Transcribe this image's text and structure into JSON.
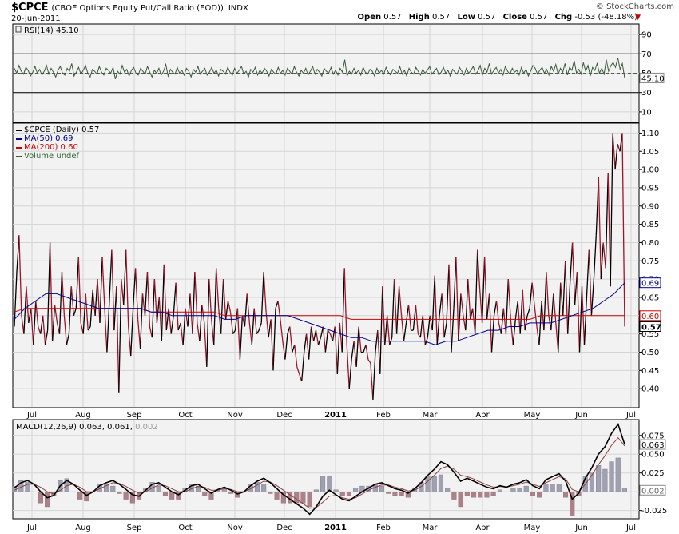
{
  "header": {
    "symbol": "$CPCE",
    "description": "(CBOE Options Equity Put/Call Ratio (EOD))",
    "exchange": "INDX",
    "credit": "© StockCharts.com",
    "date": "20-Jun-2011",
    "open_label": "Open",
    "open": "0.57",
    "high_label": "High",
    "high": "0.57",
    "low_label": "Low",
    "low": "0.57",
    "close_label": "Close",
    "close": "0.57",
    "chg_label": "Chg",
    "chg": "-0.53 (-48.18%)"
  },
  "colors": {
    "price_up": "#000000",
    "price_down": "#a0142a",
    "ma50": "#00008b",
    "ma200": "#cc0000",
    "rsi_line": "#3a5a3a",
    "macd_line": "#000000",
    "signal_line": "#8b4040",
    "hist_pos": "#a0a0b4",
    "hist_neg": "#b08088",
    "panel_bg": "#f2f2f2",
    "grid": "#d4d4d4"
  },
  "chart_data": [
    {
      "type": "line",
      "panel": "RSI",
      "legend": "RSI(14) 45.10",
      "y_ticks": [
        10,
        30,
        50,
        70,
        90
      ],
      "ylim": [
        0,
        100
      ],
      "overbought": 70,
      "oversold": 30,
      "last_value": 45.1,
      "last_value_label": "45.10",
      "values": [
        55,
        50,
        58,
        52,
        49,
        56,
        53,
        47,
        51,
        57,
        50,
        54,
        48,
        52,
        58,
        49,
        55,
        51,
        46,
        53,
        57,
        50,
        48,
        55,
        52,
        60,
        47,
        51,
        56,
        49,
        53,
        58,
        50,
        46,
        54,
        52,
        49,
        57,
        51,
        48,
        55,
        53,
        50,
        56,
        44,
        52,
        49,
        58,
        51,
        54,
        47,
        53,
        56,
        50,
        48,
        55,
        52,
        49,
        57,
        51,
        46,
        53,
        50,
        55,
        48,
        52,
        59,
        47,
        54,
        51,
        49,
        56,
        50,
        53,
        48,
        55,
        52,
        46,
        54,
        51,
        57,
        49,
        52,
        55,
        48,
        51,
        56,
        50,
        53,
        47,
        54,
        52,
        49,
        56,
        51,
        48,
        55,
        50,
        53,
        57,
        49,
        52,
        46,
        54,
        51,
        56,
        48,
        53,
        50,
        55,
        52,
        47,
        54,
        51,
        49,
        56,
        50,
        53,
        48,
        55,
        52,
        49,
        57,
        51,
        47,
        53,
        50,
        55,
        48,
        52,
        57,
        49,
        54,
        51,
        47,
        55,
        52,
        50,
        56,
        49,
        53,
        48,
        55,
        51,
        64,
        47,
        52,
        49,
        55,
        50,
        53,
        48,
        56,
        51,
        49,
        54,
        52,
        47,
        55,
        50,
        53,
        49,
        56,
        51,
        48,
        54,
        52,
        50,
        57,
        49,
        53,
        47,
        55,
        51,
        49,
        56,
        52,
        48,
        54,
        50,
        53,
        57,
        49,
        52,
        55,
        48,
        51,
        56,
        50,
        53,
        47,
        54,
        51,
        49,
        56,
        52,
        48,
        55,
        50,
        53,
        57,
        49,
        52,
        58,
        48,
        55,
        51,
        60,
        49,
        53,
        56,
        50,
        54,
        48,
        57,
        52,
        49,
        55,
        51,
        53,
        48,
        56,
        50,
        54,
        47,
        52,
        58,
        55,
        49,
        53,
        56,
        50,
        54,
        48,
        57,
        52,
        59,
        49,
        55,
        51,
        60,
        48,
        56,
        53,
        63,
        50,
        54,
        49,
        61,
        52,
        58,
        47,
        56,
        53,
        60,
        50,
        55,
        49,
        64,
        52,
        58,
        61,
        56,
        66,
        54,
        60,
        45
      ]
    },
    {
      "type": "line",
      "panel": "Price",
      "legend": [
        "$CPCE (Daily) 0.57",
        "MA(50) 0.69",
        "MA(200) 0.60",
        "Volume undef"
      ],
      "series": [
        {
          "name": "$CPCE (Daily)",
          "values": [
            0.57,
            0.72,
            0.82,
            0.6,
            0.55,
            0.68,
            0.58,
            0.62,
            0.52,
            0.64,
            0.57,
            0.55,
            0.6,
            0.52,
            0.56,
            0.8,
            0.53,
            0.63,
            0.58,
            0.55,
            0.72,
            0.6,
            0.52,
            0.55,
            0.68,
            0.6,
            0.62,
            0.76,
            0.58,
            0.55,
            0.66,
            0.56,
            0.57,
            0.67,
            0.6,
            0.7,
            0.58,
            0.76,
            0.62,
            0.5,
            0.64,
            0.78,
            0.56,
            0.68,
            0.39,
            0.7,
            0.63,
            0.78,
            0.57,
            0.49,
            0.62,
            0.73,
            0.59,
            0.51,
            0.66,
            0.6,
            0.72,
            0.57,
            0.54,
            0.7,
            0.58,
            0.65,
            0.53,
            0.74,
            0.56,
            0.62,
            0.55,
            0.6,
            0.69,
            0.56,
            0.58,
            0.52,
            0.62,
            0.57,
            0.66,
            0.55,
            0.72,
            0.58,
            0.53,
            0.63,
            0.58,
            0.46,
            0.7,
            0.59,
            0.52,
            0.73,
            0.62,
            0.55,
            0.7,
            0.59,
            0.64,
            0.61,
            0.55,
            0.56,
            0.62,
            0.48,
            0.6,
            0.57,
            0.66,
            0.58,
            0.52,
            0.62,
            0.55,
            0.56,
            0.58,
            0.72,
            0.61,
            0.54,
            0.59,
            0.45,
            0.62,
            0.64,
            0.59,
            0.53,
            0.48,
            0.55,
            0.57,
            0.5,
            0.52,
            0.46,
            0.44,
            0.42,
            0.5,
            0.55,
            0.48,
            0.57,
            0.53,
            0.56,
            0.52,
            0.54,
            0.57,
            0.5,
            0.56,
            0.55,
            0.53,
            0.57,
            0.44,
            0.58,
            0.5,
            0.73,
            0.52,
            0.4,
            0.48,
            0.53,
            0.46,
            0.57,
            0.5,
            0.5,
            0.52,
            0.48,
            0.47,
            0.37,
            0.5,
            0.56,
            0.44,
            0.68,
            0.52,
            0.6,
            0.52,
            0.54,
            0.7,
            0.55,
            0.68,
            0.6,
            0.53,
            0.58,
            0.63,
            0.56,
            0.56,
            0.63,
            0.55,
            0.54,
            0.6,
            0.52,
            0.54,
            0.6,
            0.56,
            0.71,
            0.52,
            0.6,
            0.66,
            0.54,
            0.58,
            0.74,
            0.5,
            0.62,
            0.76,
            0.53,
            0.66,
            0.6,
            0.56,
            0.7,
            0.59,
            0.62,
            0.55,
            0.78,
            0.67,
            0.58,
            0.76,
            0.59,
            0.66,
            0.5,
            0.6,
            0.64,
            0.58,
            0.55,
            0.62,
            0.55,
            0.7,
            0.59,
            0.52,
            0.59,
            0.64,
            0.55,
            0.67,
            0.56,
            0.6,
            0.62,
            0.69,
            0.63,
            0.57,
            0.52,
            0.64,
            0.56,
            0.72,
            0.6,
            0.56,
            0.66,
            0.58,
            0.5,
            0.69,
            0.6,
            0.75,
            0.55,
            0.69,
            0.8,
            0.63,
            0.72,
            0.5,
            0.68,
            0.52,
            0.65,
            0.78,
            0.6,
            0.7,
            0.82,
            0.98,
            0.7,
            0.8,
            0.73,
            0.99,
            0.68,
            1.1,
            1.0,
            1.07,
            1.05,
            1.1,
            0.57
          ]
        },
        {
          "name": "MA(50)",
          "values": [
            0.59,
            0.62,
            0.64,
            0.66,
            0.66,
            0.65,
            0.64,
            0.63,
            0.62,
            0.62,
            0.62,
            0.62,
            0.62,
            0.61,
            0.61,
            0.6,
            0.6,
            0.6,
            0.6,
            0.6,
            0.59,
            0.59,
            0.6,
            0.6,
            0.6,
            0.6,
            0.6,
            0.59,
            0.58,
            0.57,
            0.56,
            0.55,
            0.54,
            0.54,
            0.53,
            0.53,
            0.53,
            0.53,
            0.53,
            0.53,
            0.52,
            0.53,
            0.53,
            0.54,
            0.55,
            0.56,
            0.56,
            0.57,
            0.57,
            0.58,
            0.58,
            0.58,
            0.59,
            0.6,
            0.61,
            0.62,
            0.64,
            0.66,
            0.69
          ]
        },
        {
          "name": "MA(200)",
          "values": [
            0.61,
            0.62,
            0.62,
            0.62,
            0.62,
            0.62,
            0.62,
            0.62,
            0.62,
            0.62,
            0.62,
            0.62,
            0.62,
            0.61,
            0.61,
            0.61,
            0.61,
            0.61,
            0.61,
            0.61,
            0.6,
            0.6,
            0.6,
            0.6,
            0.6,
            0.6,
            0.6,
            0.6,
            0.6,
            0.6,
            0.6,
            0.6,
            0.59,
            0.59,
            0.59,
            0.59,
            0.59,
            0.59,
            0.59,
            0.59,
            0.59,
            0.59,
            0.59,
            0.59,
            0.59,
            0.59,
            0.59,
            0.59,
            0.59,
            0.59,
            0.6,
            0.6,
            0.6,
            0.6,
            0.6,
            0.6,
            0.6,
            0.6,
            0.6
          ]
        }
      ],
      "y_ticks": [
        "0.40",
        "0.45",
        "0.50",
        "0.55",
        "0.60",
        "0.65",
        "0.70",
        "0.75",
        "0.80",
        "0.85",
        "0.90",
        "0.95",
        "1.00",
        "1.05",
        "1.10"
      ],
      "ylim": [
        0.35,
        1.125
      ],
      "last_labels": {
        "close": "0.57",
        "ma50": "0.69",
        "ma200": "0.60"
      }
    },
    {
      "type": "line",
      "panel": "MACD",
      "legend_main": "MACD(12,26,9) 0.063, 0.061, ",
      "legend_hist": "0.002",
      "y_ticks": [
        "-0.025",
        "0.002",
        "0.025",
        "0.050",
        "0.063",
        "0.075"
      ],
      "ylim": [
        -0.035,
        0.095
      ],
      "last_labels": {
        "macd": "0.063",
        "hist": "0.002"
      },
      "series": [
        {
          "name": "MACD",
          "values": [
            0.005,
            0.012,
            0.015,
            0.01,
            0.0,
            -0.008,
            -0.005,
            0.008,
            0.015,
            0.01,
            0.002,
            -0.005,
            0.0,
            0.008,
            0.012,
            0.015,
            0.01,
            0.003,
            -0.004,
            -0.006,
            0.002,
            0.01,
            0.012,
            0.006,
            0.0,
            -0.004,
            0.002,
            0.008,
            0.01,
            0.004,
            -0.002,
            0.003,
            0.006,
            0.002,
            -0.003,
            0.0,
            0.008,
            0.014,
            0.018,
            0.012,
            0.004,
            -0.004,
            -0.01,
            -0.016,
            -0.022,
            -0.03,
            -0.02,
            -0.006,
            0.002,
            -0.004,
            -0.01,
            -0.012,
            -0.006,
            0.0,
            0.005,
            0.01,
            0.012,
            0.008,
            0.004,
            0.002,
            -0.002,
            0.004,
            0.012,
            0.022,
            0.03,
            0.04,
            0.036,
            0.026,
            0.014,
            0.018,
            0.014,
            0.01,
            0.006,
            0.004,
            0.008,
            0.006,
            0.01,
            0.012,
            0.016,
            0.008,
            0.004,
            0.016,
            0.02,
            0.024,
            0.014,
            -0.01,
            -0.002,
            0.018,
            0.032,
            0.05,
            0.06,
            0.078,
            0.09,
            0.063
          ]
        },
        {
          "name": "Signal",
          "values": [
            0.002,
            0.006,
            0.01,
            0.01,
            0.006,
            0.0,
            -0.003,
            0.002,
            0.008,
            0.01,
            0.006,
            0.0,
            0.0,
            0.004,
            0.008,
            0.012,
            0.011,
            0.007,
            0.002,
            -0.002,
            0.0,
            0.005,
            0.009,
            0.008,
            0.004,
            0.0,
            0.0,
            0.004,
            0.007,
            0.006,
            0.002,
            0.002,
            0.004,
            0.003,
            0.0,
            0.0,
            0.004,
            0.009,
            0.014,
            0.013,
            0.008,
            0.002,
            -0.004,
            -0.01,
            -0.016,
            -0.022,
            -0.021,
            -0.014,
            -0.006,
            -0.005,
            -0.008,
            -0.01,
            -0.008,
            -0.003,
            0.002,
            0.006,
            0.009,
            0.009,
            0.006,
            0.004,
            0.001,
            0.002,
            0.007,
            0.014,
            0.022,
            0.031,
            0.034,
            0.03,
            0.022,
            0.02,
            0.017,
            0.013,
            0.009,
            0.006,
            0.007,
            0.006,
            0.008,
            0.01,
            0.013,
            0.01,
            0.007,
            0.012,
            0.016,
            0.02,
            0.017,
            0.003,
            0.0,
            0.01,
            0.022,
            0.036,
            0.048,
            0.062,
            0.072,
            0.061
          ]
        }
      ]
    }
  ],
  "x_axis": {
    "labels": [
      "Jul",
      "Aug",
      "Sep",
      "Oct",
      "Nov",
      "Dec",
      "2011",
      "Feb",
      "Mar",
      "Apr",
      "May",
      "Jun",
      "Jul"
    ],
    "bold": "2011"
  }
}
